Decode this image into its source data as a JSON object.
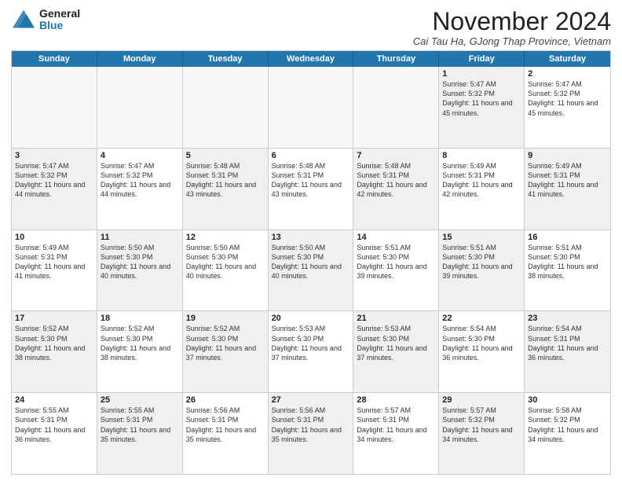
{
  "logo": {
    "general": "General",
    "blue": "Blue"
  },
  "header": {
    "month": "November 2024",
    "location": "Cai Tau Ha, GJong Thap Province, Vietnam"
  },
  "weekdays": [
    "Sunday",
    "Monday",
    "Tuesday",
    "Wednesday",
    "Thursday",
    "Friday",
    "Saturday"
  ],
  "rows": [
    [
      {
        "day": "",
        "text": "",
        "empty": true
      },
      {
        "day": "",
        "text": "",
        "empty": true
      },
      {
        "day": "",
        "text": "",
        "empty": true
      },
      {
        "day": "",
        "text": "",
        "empty": true
      },
      {
        "day": "",
        "text": "",
        "empty": true
      },
      {
        "day": "1",
        "text": "Sunrise: 5:47 AM\nSunset: 5:32 PM\nDaylight: 11 hours and 45 minutes.",
        "shaded": true
      },
      {
        "day": "2",
        "text": "Sunrise: 5:47 AM\nSunset: 5:32 PM\nDaylight: 11 hours and 45 minutes.",
        "shaded": false
      }
    ],
    [
      {
        "day": "3",
        "text": "Sunrise: 5:47 AM\nSunset: 5:32 PM\nDaylight: 11 hours and 44 minutes.",
        "shaded": true
      },
      {
        "day": "4",
        "text": "Sunrise: 5:47 AM\nSunset: 5:32 PM\nDaylight: 11 hours and 44 minutes.",
        "shaded": false
      },
      {
        "day": "5",
        "text": "Sunrise: 5:48 AM\nSunset: 5:31 PM\nDaylight: 11 hours and 43 minutes.",
        "shaded": true
      },
      {
        "day": "6",
        "text": "Sunrise: 5:48 AM\nSunset: 5:31 PM\nDaylight: 11 hours and 43 minutes.",
        "shaded": false
      },
      {
        "day": "7",
        "text": "Sunrise: 5:48 AM\nSunset: 5:31 PM\nDaylight: 11 hours and 42 minutes.",
        "shaded": true
      },
      {
        "day": "8",
        "text": "Sunrise: 5:49 AM\nSunset: 5:31 PM\nDaylight: 11 hours and 42 minutes.",
        "shaded": false
      },
      {
        "day": "9",
        "text": "Sunrise: 5:49 AM\nSunset: 5:31 PM\nDaylight: 11 hours and 41 minutes.",
        "shaded": true
      }
    ],
    [
      {
        "day": "10",
        "text": "Sunrise: 5:49 AM\nSunset: 5:31 PM\nDaylight: 11 hours and 41 minutes.",
        "shaded": false
      },
      {
        "day": "11",
        "text": "Sunrise: 5:50 AM\nSunset: 5:30 PM\nDaylight: 11 hours and 40 minutes.",
        "shaded": true
      },
      {
        "day": "12",
        "text": "Sunrise: 5:50 AM\nSunset: 5:30 PM\nDaylight: 11 hours and 40 minutes.",
        "shaded": false
      },
      {
        "day": "13",
        "text": "Sunrise: 5:50 AM\nSunset: 5:30 PM\nDaylight: 11 hours and 40 minutes.",
        "shaded": true
      },
      {
        "day": "14",
        "text": "Sunrise: 5:51 AM\nSunset: 5:30 PM\nDaylight: 11 hours and 39 minutes.",
        "shaded": false
      },
      {
        "day": "15",
        "text": "Sunrise: 5:51 AM\nSunset: 5:30 PM\nDaylight: 11 hours and 39 minutes.",
        "shaded": true
      },
      {
        "day": "16",
        "text": "Sunrise: 5:51 AM\nSunset: 5:30 PM\nDaylight: 11 hours and 38 minutes.",
        "shaded": false
      }
    ],
    [
      {
        "day": "17",
        "text": "Sunrise: 5:52 AM\nSunset: 5:30 PM\nDaylight: 11 hours and 38 minutes.",
        "shaded": true
      },
      {
        "day": "18",
        "text": "Sunrise: 5:52 AM\nSunset: 5:30 PM\nDaylight: 11 hours and 38 minutes.",
        "shaded": false
      },
      {
        "day": "19",
        "text": "Sunrise: 5:52 AM\nSunset: 5:30 PM\nDaylight: 11 hours and 37 minutes.",
        "shaded": true
      },
      {
        "day": "20",
        "text": "Sunrise: 5:53 AM\nSunset: 5:30 PM\nDaylight: 11 hours and 37 minutes.",
        "shaded": false
      },
      {
        "day": "21",
        "text": "Sunrise: 5:53 AM\nSunset: 5:30 PM\nDaylight: 11 hours and 37 minutes.",
        "shaded": true
      },
      {
        "day": "22",
        "text": "Sunrise: 5:54 AM\nSunset: 5:30 PM\nDaylight: 11 hours and 36 minutes.",
        "shaded": false
      },
      {
        "day": "23",
        "text": "Sunrise: 5:54 AM\nSunset: 5:31 PM\nDaylight: 11 hours and 36 minutes.",
        "shaded": true
      }
    ],
    [
      {
        "day": "24",
        "text": "Sunrise: 5:55 AM\nSunset: 5:31 PM\nDaylight: 11 hours and 36 minutes.",
        "shaded": false
      },
      {
        "day": "25",
        "text": "Sunrise: 5:55 AM\nSunset: 5:31 PM\nDaylight: 11 hours and 35 minutes.",
        "shaded": true
      },
      {
        "day": "26",
        "text": "Sunrise: 5:56 AM\nSunset: 5:31 PM\nDaylight: 11 hours and 35 minutes.",
        "shaded": false
      },
      {
        "day": "27",
        "text": "Sunrise: 5:56 AM\nSunset: 5:31 PM\nDaylight: 11 hours and 35 minutes.",
        "shaded": true
      },
      {
        "day": "28",
        "text": "Sunrise: 5:57 AM\nSunset: 5:31 PM\nDaylight: 11 hours and 34 minutes.",
        "shaded": false
      },
      {
        "day": "29",
        "text": "Sunrise: 5:57 AM\nSunset: 5:32 PM\nDaylight: 11 hours and 34 minutes.",
        "shaded": true
      },
      {
        "day": "30",
        "text": "Sunrise: 5:58 AM\nSunset: 5:32 PM\nDaylight: 11 hours and 34 minutes.",
        "shaded": false
      }
    ]
  ]
}
